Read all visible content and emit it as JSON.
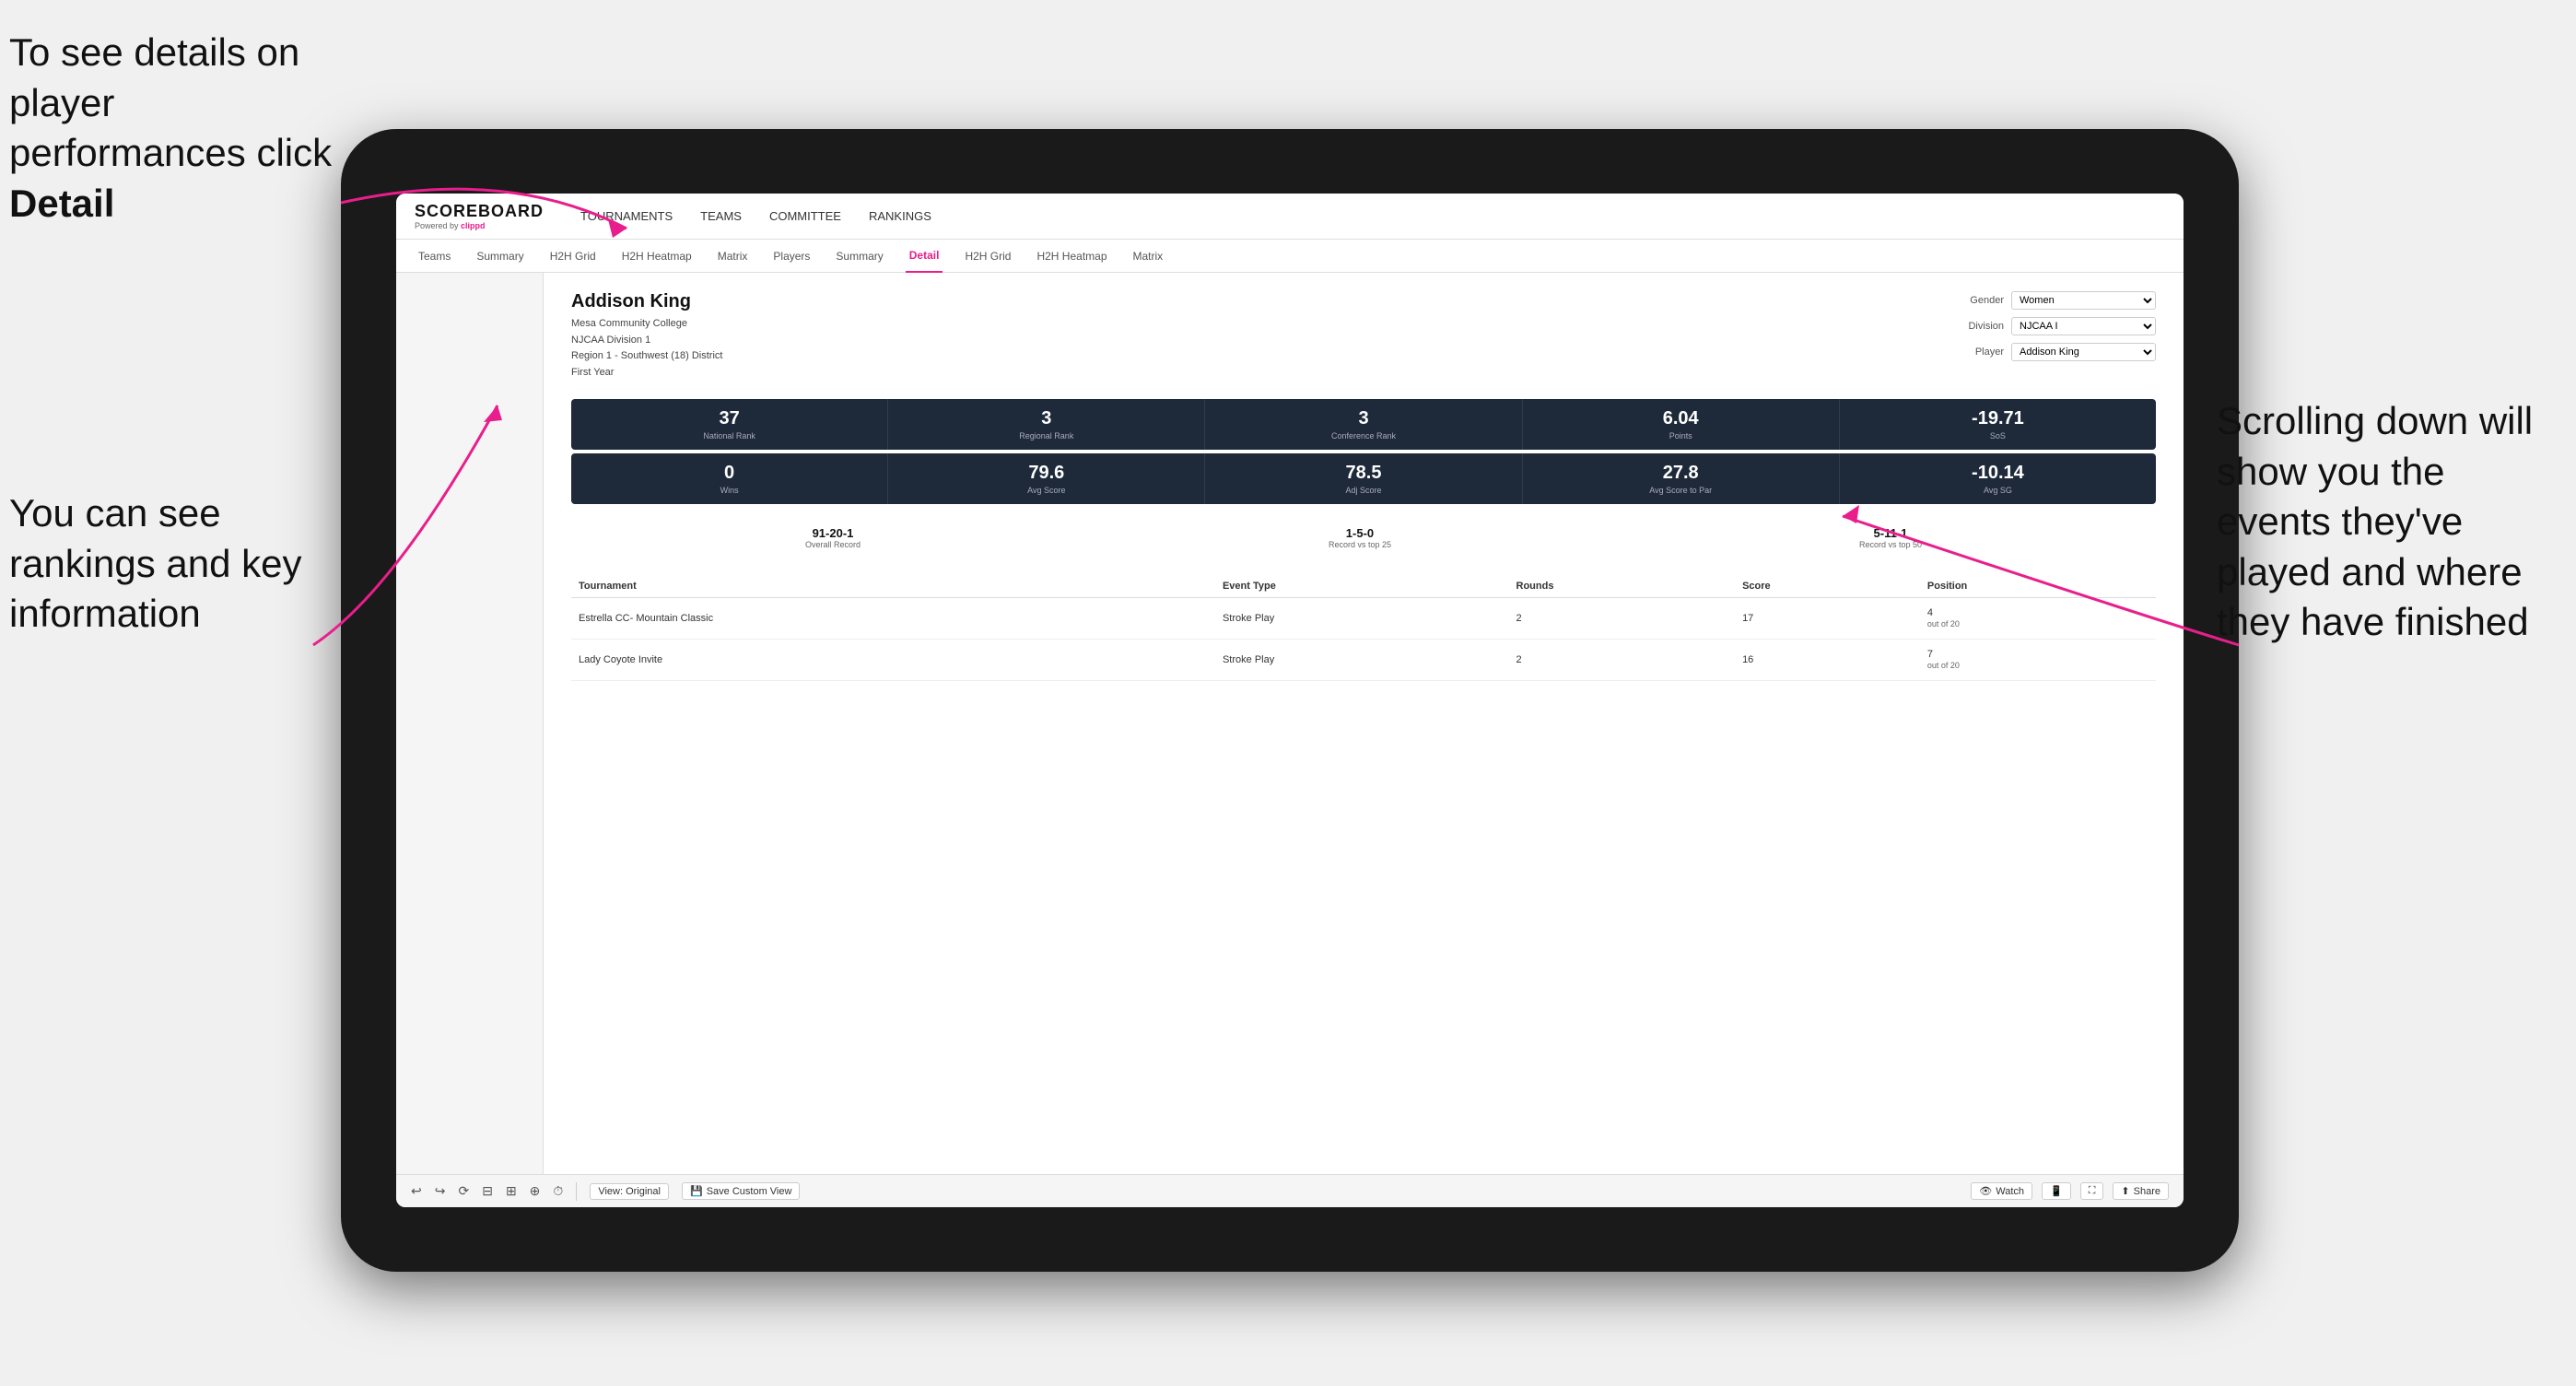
{
  "annotations": {
    "top_left": "To see details on player performances click Detail",
    "top_left_bold": "Detail",
    "bottom_left_line1": "You can see",
    "bottom_left_line2": "rankings and",
    "bottom_left_line3": "key information",
    "right_line1": "Scrolling down",
    "right_line2": "will show you",
    "right_line3": "the events",
    "right_line4": "they've played",
    "right_line5": "and where they",
    "right_line6": "have finished"
  },
  "nav": {
    "logo": "SCOREBOARD",
    "powered_by": "Powered by",
    "clippd": "clippd",
    "items": [
      {
        "label": "TOURNAMENTS",
        "active": false
      },
      {
        "label": "TEAMS",
        "active": false
      },
      {
        "label": "COMMITTEE",
        "active": false
      },
      {
        "label": "RANKINGS",
        "active": false
      }
    ]
  },
  "sub_nav": {
    "items": [
      {
        "label": "Teams",
        "active": false
      },
      {
        "label": "Summary",
        "active": false
      },
      {
        "label": "H2H Grid",
        "active": false
      },
      {
        "label": "H2H Heatmap",
        "active": false
      },
      {
        "label": "Matrix",
        "active": false
      },
      {
        "label": "Players",
        "active": false
      },
      {
        "label": "Summary",
        "active": false
      },
      {
        "label": "Detail",
        "active": true
      },
      {
        "label": "H2H Grid",
        "active": false
      },
      {
        "label": "H2H Heatmap",
        "active": false
      },
      {
        "label": "Matrix",
        "active": false
      }
    ]
  },
  "player": {
    "name": "Addison King",
    "school": "Mesa Community College",
    "division": "NJCAA Division 1",
    "region": "Region 1 - Southwest (18) District",
    "year": "First Year"
  },
  "controls": {
    "gender_label": "Gender",
    "gender_value": "Women",
    "division_label": "Division",
    "division_value": "NJCAA I",
    "player_label": "Player",
    "player_value": "Addison King"
  },
  "stats_row1": [
    {
      "value": "37",
      "label": "National Rank"
    },
    {
      "value": "3",
      "label": "Regional Rank"
    },
    {
      "value": "3",
      "label": "Conference Rank"
    },
    {
      "value": "6.04",
      "label": "Points"
    },
    {
      "value": "-19.71",
      "label": "SoS"
    }
  ],
  "stats_row2": [
    {
      "value": "0",
      "label": "Wins"
    },
    {
      "value": "79.6",
      "label": "Avg Score"
    },
    {
      "value": "78.5",
      "label": "Adj Score"
    },
    {
      "value": "27.8",
      "label": "Avg Score to Par"
    },
    {
      "value": "-10.14",
      "label": "Avg SG"
    }
  ],
  "records": [
    {
      "value": "91-20-1",
      "label": "Overall Record"
    },
    {
      "value": "1-5-0",
      "label": "Record vs top 25"
    },
    {
      "value": "5-11-1",
      "label": "Record vs top 50"
    }
  ],
  "table": {
    "headers": [
      "Tournament",
      "",
      "Event Type",
      "Rounds",
      "Score",
      "Position"
    ],
    "rows": [
      {
        "tournament": "Estrella CC- Mountain Classic",
        "event_type": "Stroke Play",
        "rounds": "2",
        "score": "17",
        "position": "4",
        "position_detail": "out of 20"
      },
      {
        "tournament": "Lady Coyote Invite",
        "event_type": "Stroke Play",
        "rounds": "2",
        "score": "16",
        "position": "7",
        "position_detail": "out of 20"
      }
    ]
  },
  "toolbar": {
    "view_original": "View: Original",
    "save_custom": "Save Custom View",
    "watch": "Watch",
    "share": "Share"
  }
}
